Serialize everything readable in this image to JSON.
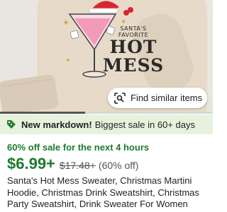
{
  "product_image": {
    "art_line1": "SANTA'S",
    "art_line2": "FAVORITE",
    "art_line3": "HOT MESS"
  },
  "find_similar": {
    "label": "Find similar items",
    "icon": "image-search-icon"
  },
  "carousel": {
    "progress": 0.4
  },
  "markdown_banner": {
    "icon": "price-tag-icon",
    "strong": "New markdown!",
    "text": "Biggest sale in 60+ days",
    "background": "#e6f2dd"
  },
  "sale": {
    "timer_text": "60% off sale for the next 4 hours",
    "price": "$6.99+",
    "original_price": "$17.48+",
    "discount": "(60% off)",
    "accent_color": "#1c7a2e"
  },
  "product": {
    "title": "Santa's Hot Mess Sweater, Christmas Martini Hoodie, Christmas Drink Sweatshirt, Christmas Party Sweatshirt, Drink Sweater For Women"
  }
}
